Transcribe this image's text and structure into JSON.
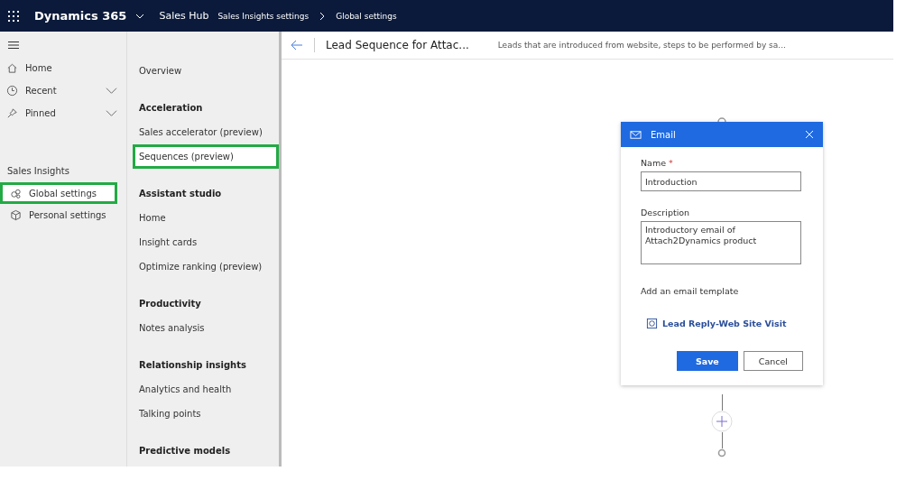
{
  "top_bar": {
    "app_name": "Dynamics 365",
    "area": "Sales Hub",
    "breadcrumb": [
      "Sales Insights settings",
      "Global settings"
    ]
  },
  "sidebar": {
    "items": [
      {
        "label": "Home",
        "kind": "link"
      },
      {
        "label": "Recent",
        "kind": "group",
        "expanded": false
      },
      {
        "label": "Pinned",
        "kind": "group",
        "expanded": false
      }
    ],
    "section": "Sales Insights",
    "section_items": [
      {
        "label": "Global settings",
        "selected": true,
        "highlighted": true
      },
      {
        "label": "Personal settings",
        "selected": false,
        "highlighted": false
      }
    ]
  },
  "settings_nav": [
    {
      "kind": "item",
      "label": "Overview",
      "selected": false,
      "highlighted": false
    },
    {
      "kind": "heading",
      "label": "Acceleration"
    },
    {
      "kind": "item",
      "label": "Sales accelerator (preview)",
      "selected": false,
      "highlighted": false
    },
    {
      "kind": "item",
      "label": "Sequences (preview)",
      "selected": true,
      "highlighted": true
    },
    {
      "kind": "heading",
      "label": "Assistant studio"
    },
    {
      "kind": "item",
      "label": "Home",
      "selected": false,
      "highlighted": false
    },
    {
      "kind": "item",
      "label": "Insight cards",
      "selected": false,
      "highlighted": false
    },
    {
      "kind": "item",
      "label": "Optimize ranking (preview)",
      "selected": false,
      "highlighted": false
    },
    {
      "kind": "heading",
      "label": "Productivity"
    },
    {
      "kind": "item",
      "label": "Notes analysis",
      "selected": false,
      "highlighted": false
    },
    {
      "kind": "heading",
      "label": "Relationship insights"
    },
    {
      "kind": "item",
      "label": "Analytics and health",
      "selected": false,
      "highlighted": false
    },
    {
      "kind": "item",
      "label": "Talking points",
      "selected": false,
      "highlighted": false
    },
    {
      "kind": "heading",
      "label": "Predictive models"
    }
  ],
  "header": {
    "title": "Lead Sequence for Attac...",
    "description": "Leads that are introduced from website, steps to be performed by sa..."
  },
  "email_card": {
    "title": "Email",
    "name_label": "Name",
    "required_mark": "*",
    "name_value": "Introduction",
    "description_label": "Description",
    "description_value": "Introductory email of\nAttach2Dynamics product",
    "template_label": "Add an email template",
    "template_link": "Lead Reply-Web Site Visit",
    "buttons": [
      {
        "label": "Save",
        "kind": "primary"
      },
      {
        "label": "Cancel",
        "kind": "secondary"
      }
    ]
  }
}
